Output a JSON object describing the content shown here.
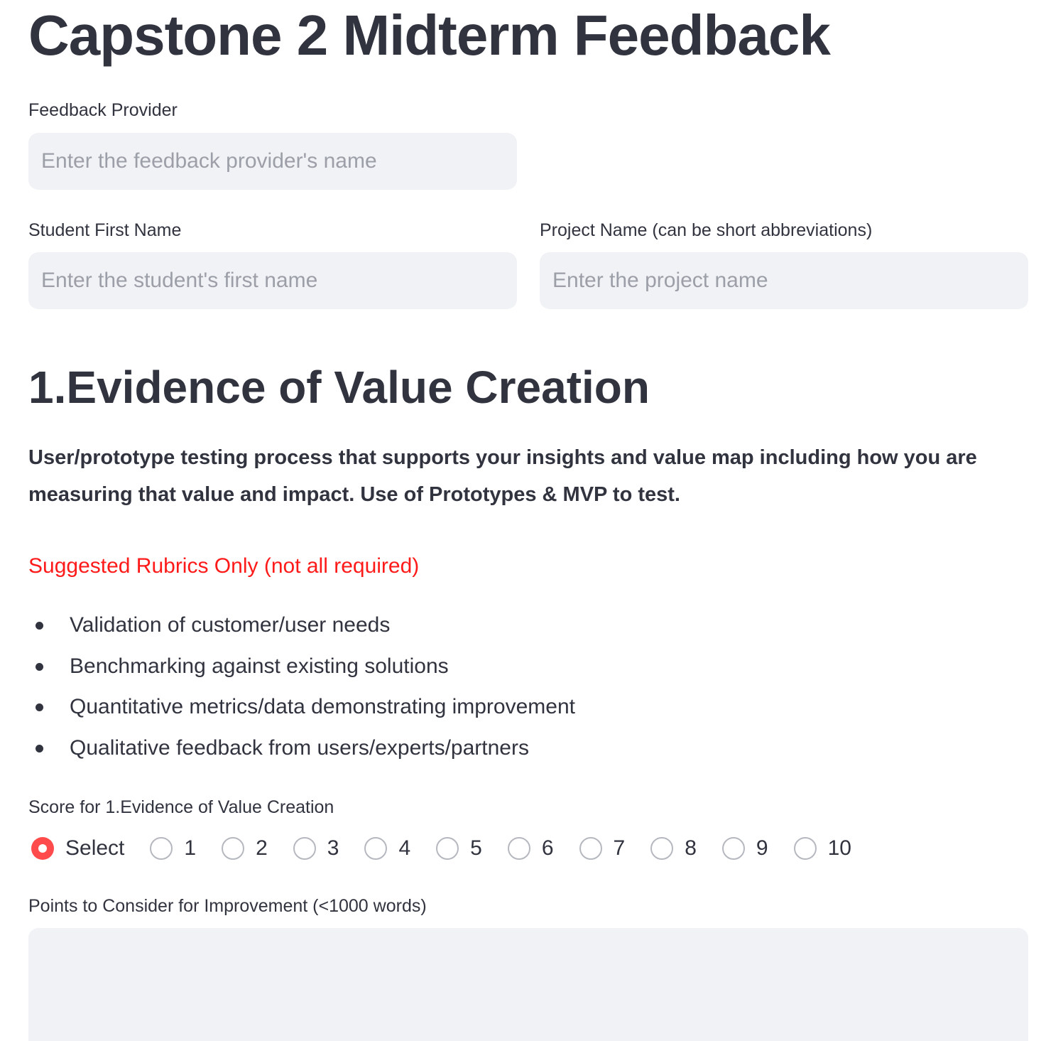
{
  "page": {
    "title": "Capstone 2 Midterm Feedback"
  },
  "fields": {
    "feedback_provider": {
      "label": "Feedback Provider",
      "value": "",
      "placeholder": "Enter the feedback provider's name"
    },
    "student_first_name": {
      "label": "Student First Name",
      "value": "",
      "placeholder": "Enter the student's first name"
    },
    "project_name": {
      "label": "Project Name (can be short abbreviations)",
      "value": "",
      "placeholder": "Enter the project name"
    }
  },
  "section1": {
    "heading": "1.Evidence of Value Creation",
    "description": "User/prototype testing process that supports your insights and value map including how you are measuring that value and impact. Use of Prototypes & MVP to test.",
    "suggested_note": "Suggested Rubrics Only (not all required)",
    "rubrics": [
      "Validation of customer/user needs",
      "Benchmarking against existing solutions",
      "Quantitative metrics/data demonstrating improvement",
      "Qualitative feedback from users/experts/partners"
    ],
    "score": {
      "label": "Score for 1.Evidence of Value Creation",
      "selected": "Select",
      "options": [
        "Select",
        "1",
        "2",
        "3",
        "4",
        "5",
        "6",
        "7",
        "8",
        "9",
        "10"
      ]
    },
    "improvement": {
      "label": "Points to Consider for Improvement (<1000 words)",
      "value": ""
    }
  },
  "colors": {
    "text": "#31333f",
    "input_background": "#f0f2f6",
    "accent": "#ff4b4b",
    "warning_text": "#ff1a1a"
  }
}
